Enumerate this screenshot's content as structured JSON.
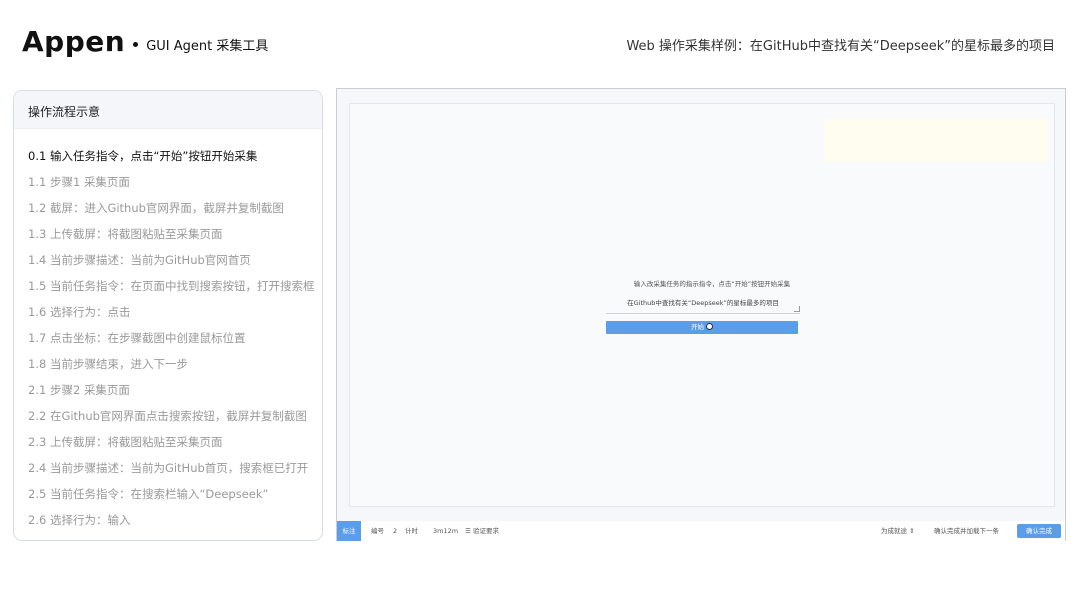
{
  "header": {
    "logo": "Appen",
    "subtitle": "GUI Agent 采集工具",
    "page_title": "Web 操作采集样例：在GitHub中查找有关“Deepseek”的星标最多的项目"
  },
  "flow": {
    "title": "操作流程示意",
    "items": [
      "0.1 输入任务指令，点击“开始”按钮开始采集",
      "1.1 步骤1 采集页面",
      "1.2 截屏：进入Github官网界面，截屏并复制截图",
      "1.3 上传截屏：将截图粘贴至采集页面",
      "1.4 当前步骤描述：当前为GitHub官网首页",
      "1.5 当前任务指令：在页面中找到搜索按钮，打开搜索框",
      "1.6 选择行为：点击",
      "1.7 点击坐标：在步骤截图中创建鼠标位置",
      "1.8 当前步骤结束，进入下一步",
      "2.1 步骤2 采集页面",
      "2.2 在Github官网界面点击搜索按钮，截屏并复制截图",
      "2.3 上传截屏：将截图粘贴至采集页面",
      "2.4 当前步骤描述：当前为GitHub首页，搜索框已打开",
      "2.5 当前任务指令：在搜索栏输入“Deepseek”",
      "2.6 选择行为：输入"
    ]
  },
  "capture": {
    "instruction": "输入改采集任务的指示指令，点击“开始”按钮开始采集",
    "task_text": "在Github中查找有关“Deepseek”的星标最多的项目",
    "start_label": "开始",
    "bottom": {
      "mark_label": "标注",
      "id_label": "编号",
      "id_value": "2",
      "timer_label": "计时",
      "timer_value": "3m12m",
      "info_label": "验证要求",
      "status_label": "为成就途 ⇕",
      "next_label": "确认完成并加载下一条",
      "confirm_label": "确认完成"
    }
  },
  "colors": {
    "accent": "#5b9de8"
  }
}
